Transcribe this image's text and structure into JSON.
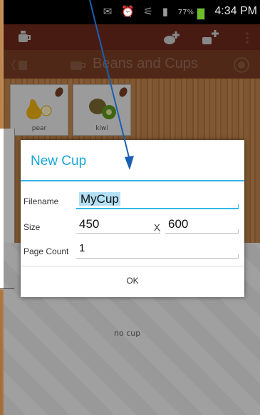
{
  "status_bar": {
    "time": "4:34 PM",
    "battery_percent": "77%"
  },
  "app": {
    "title": "Beans and Cups"
  },
  "tiles": [
    {
      "label": "pear"
    },
    {
      "label": "kiwi"
    }
  ],
  "empty_state": {
    "text": "no cup"
  },
  "dialog": {
    "title": "New Cup",
    "filename_label": "Filename",
    "filename_value": "MyCup",
    "size_label": "Size",
    "width_value": "450",
    "separator": "X",
    "height_value": "600",
    "page_count_label": "Page Count",
    "page_count_value": "1",
    "ok_label": "OK"
  },
  "colors": {
    "accent": "#33b5e5",
    "action_bar": "#6e2a1d",
    "arrow": "#1a5fb4"
  }
}
